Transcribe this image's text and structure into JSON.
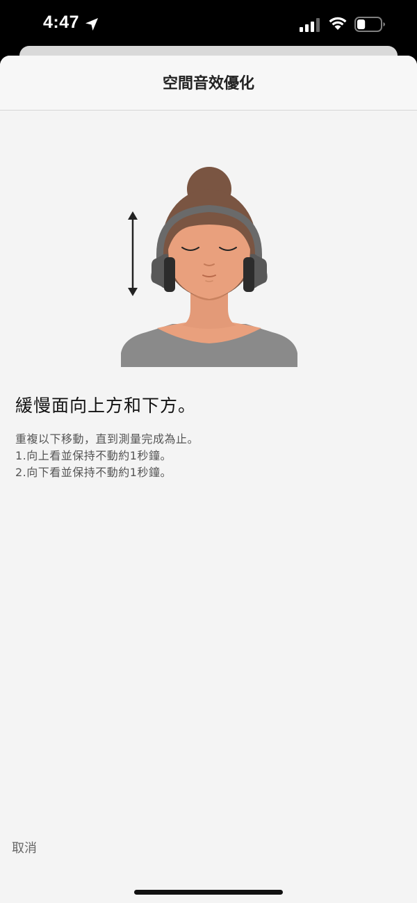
{
  "status_bar": {
    "time": "4:47",
    "icons": [
      "location-arrow-icon",
      "cellular-signal-icon",
      "wifi-icon",
      "battery-icon"
    ],
    "battery_level": 0.35
  },
  "header": {
    "title": "空間音效優化"
  },
  "illustration": {
    "description_icon": "head-tilt-up-down-illustration",
    "colors": {
      "skin": "#e9a07d",
      "hair": "#7a5542",
      "headphones": "#585858",
      "shirt": "#8a8a8a",
      "arrow": "#222222"
    }
  },
  "content": {
    "heading": "緩慢面向上方和下方。",
    "instructions": [
      "重複以下移動，直到測量完成為止。",
      "1.向上看並保持不動約1秒鐘。",
      "2.向下看並保持不動約1秒鐘。"
    ]
  },
  "footer": {
    "cancel_label": "取消"
  }
}
